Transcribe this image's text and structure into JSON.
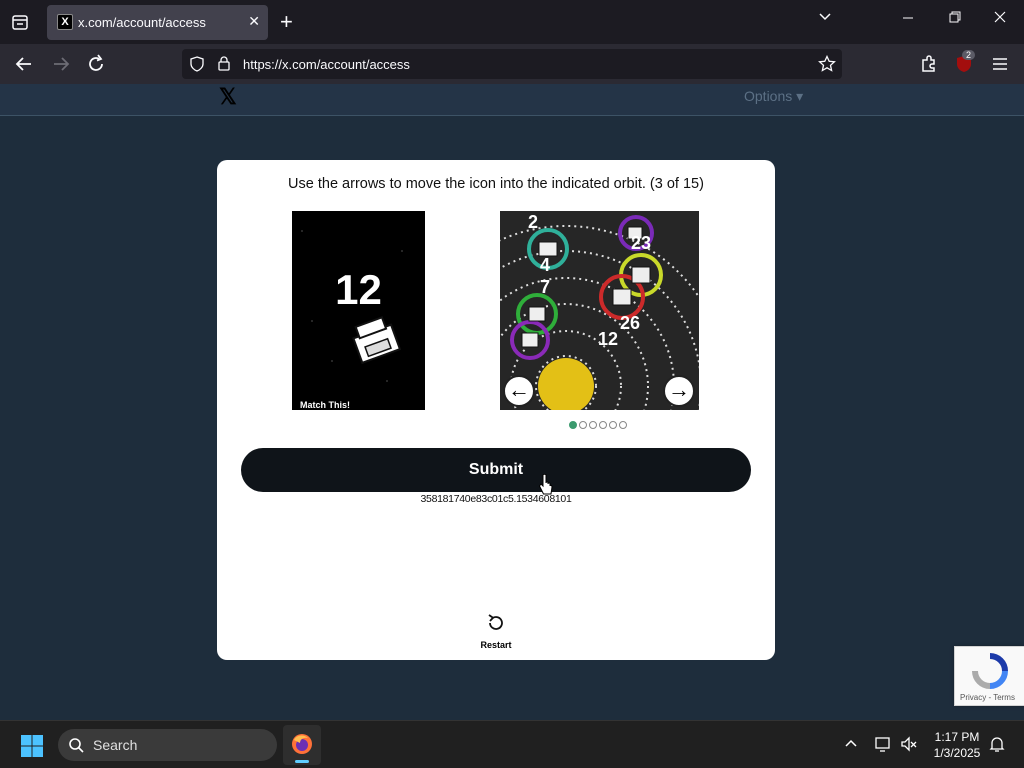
{
  "browser": {
    "tab_title": "x.com/account/access",
    "tab_favicon": "X",
    "url": "https://x.com/account/access",
    "extension_badge": "2"
  },
  "page": {
    "logo": "𝕏",
    "options_label": "Options ▾"
  },
  "captcha": {
    "instruction": "Use the arrows to move the icon into the indicated orbit. (3 of 15)",
    "target_number": "12",
    "match_label": "Match This!",
    "orbit_labels": [
      "2",
      "23",
      "4",
      "7",
      "26",
      "12"
    ],
    "left_arrow": "←",
    "right_arrow": "→",
    "page_count": 6,
    "active_page": 1,
    "submit_label": "Submit",
    "session_id": "358181740e83c01c5.1534608101",
    "restart_label": "Restart"
  },
  "recaptcha": {
    "links": "Privacy - Terms"
  },
  "taskbar": {
    "search_placeholder": "Search",
    "time": "1:17 PM",
    "date": "1/3/2025"
  },
  "colors": {
    "page_bg": "#1e2d3c",
    "submit_bg": "#0f1419",
    "active_dot": "#3b9a6e"
  }
}
